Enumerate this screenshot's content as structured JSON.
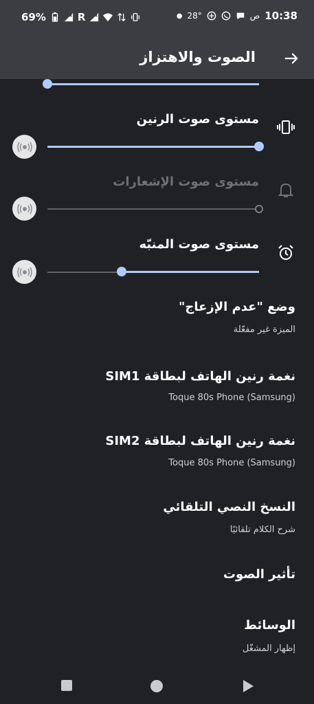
{
  "status_bar": {
    "battery": "69%",
    "net_r": "R",
    "time": "10:38",
    "am_pm": "ص",
    "temp": "28°"
  },
  "header": {
    "title": "الصوت والاهتزاز",
    "back_icon": "arrow-right-icon"
  },
  "sliders": {
    "top_partial": {
      "level": 1.0
    },
    "ring": {
      "label": "مستوى صوت الرنين",
      "level": 1.0,
      "icon": "vibrate-icon",
      "enabled": true
    },
    "notification": {
      "label": "مستوى صوت الإشعارات",
      "level": 1.0,
      "icon": "bell-icon",
      "enabled": false
    },
    "alarm": {
      "label": "مستوى صوت المنبّه",
      "level": 0.35,
      "icon": "alarm-clock-icon",
      "enabled": true
    }
  },
  "items": [
    {
      "title": "وضع \"عدم الإزعاج\"",
      "subtitle": "الميزة غير مفعّلة"
    },
    {
      "title": "نغمة رنين الهاتف لبطاقة SIM1",
      "subtitle": "Toque 80s Phone (Samsung)"
    },
    {
      "title": "نغمة رنين الهاتف لبطاقة SIM2",
      "subtitle": "Toque 80s Phone (Samsung)"
    },
    {
      "title": "النسخ النصي التلقائي",
      "subtitle": "شرح الكلام تلقائيًا"
    },
    {
      "title": "تأثير الصوت",
      "subtitle": ""
    },
    {
      "title": "الوسائط",
      "subtitle": "إظهار المشغّل"
    }
  ],
  "colors": {
    "accent": "#aecbfa",
    "background": "#202125",
    "header": "#3b3d42"
  },
  "nav": {
    "recents": "square-icon",
    "home": "circle-icon",
    "back": "triangle-icon"
  }
}
